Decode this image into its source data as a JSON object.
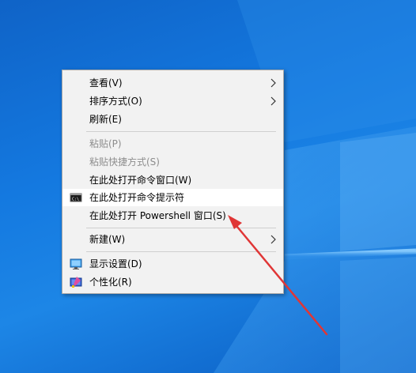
{
  "context_menu": {
    "items": [
      {
        "label": "查看(V)"
      },
      {
        "label": "排序方式(O)"
      },
      {
        "label": "刷新(E)"
      },
      {
        "label": "粘贴(P)"
      },
      {
        "label": "粘贴快捷方式(S)"
      },
      {
        "label": "在此处打开命令窗口(W)"
      },
      {
        "label": "在此处打开命令提示符"
      },
      {
        "label": "在此处打开 Powershell 窗口(S)"
      },
      {
        "label": "新建(W)"
      },
      {
        "label": "显示设置(D)"
      },
      {
        "label": "个性化(R)"
      }
    ],
    "icons": [
      "cmd-icon",
      "display-settings-icon",
      "personalize-icon"
    ]
  },
  "annotation": {
    "color": "#e03636",
    "icon": "red-arrow"
  },
  "colors": {
    "desktop": "#1479e0",
    "menu_bg": "#f2f2f2",
    "highlight": "#ffffff",
    "disabled_text": "#8d8d8d"
  }
}
